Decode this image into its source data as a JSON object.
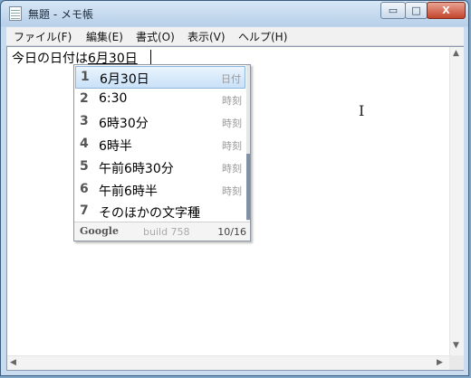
{
  "window": {
    "title": "無題 - メモ帳",
    "controls": {
      "minimize": "▭",
      "maximize": "□",
      "close": "X"
    }
  },
  "menu": {
    "items": [
      "ファイル(F)",
      "編集(E)",
      "書式(O)",
      "表示(V)",
      "ヘルプ(H)"
    ]
  },
  "editor": {
    "committed_text": "今日の日付は",
    "composition_text": "6月30日"
  },
  "candidates": {
    "items": [
      {
        "index": "1",
        "text": "6月30日",
        "annotation": "日付",
        "selected": true
      },
      {
        "index": "2",
        "text": "6:30",
        "annotation": "時刻"
      },
      {
        "index": "3",
        "text": "6時30分",
        "annotation": "時刻"
      },
      {
        "index": "4",
        "text": "6時半",
        "annotation": "時刻"
      },
      {
        "index": "5",
        "text": "午前6時30分",
        "annotation": "時刻"
      },
      {
        "index": "6",
        "text": "午前6時半",
        "annotation": "時刻"
      },
      {
        "index": "7",
        "text": "そのほかの文字種",
        "annotation": ""
      }
    ],
    "footer": {
      "brand": "Google",
      "build": "build 758",
      "position": "10/16"
    }
  },
  "icons": [
    "notepad-icon",
    "ibeam-cursor-icon",
    "scroll-arrow-icons"
  ],
  "colors": {
    "selection": "#c9e1f8",
    "accent": "#3b5d80"
  }
}
